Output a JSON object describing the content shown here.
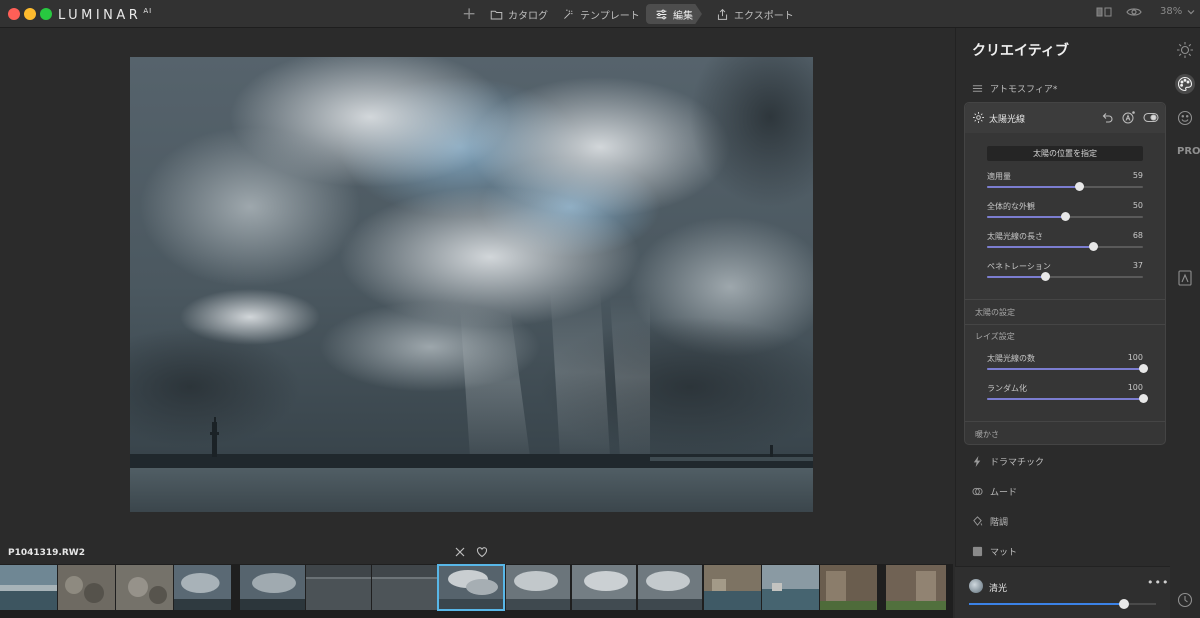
{
  "app": {
    "logo": "LUMINAR",
    "logo_suffix": "AI"
  },
  "nav": {
    "catalog": "カタログ",
    "template": "テンプレート",
    "edit": "編集",
    "export": "エクスポート",
    "zoom": "38%"
  },
  "filename": "P1041319.RW2",
  "panel": {
    "title": "クリエイティブ",
    "atmosphere": "アトモスフィア*",
    "sunrays": {
      "title": "太陽光線",
      "place_sun_button": "太陽の位置を指定",
      "sliders": [
        {
          "label": "適用量",
          "value": 59,
          "fraction": 0.59
        },
        {
          "label": "全体的な外観",
          "value": 50,
          "fraction": 0.5
        },
        {
          "label": "太陽光線の長さ",
          "value": 68,
          "fraction": 0.68
        },
        {
          "label": "ペネトレーション",
          "value": 37,
          "fraction": 0.37
        }
      ],
      "sun_settings": "太陽の設定",
      "ray_settings": "レイズ設定",
      "ray_sliders": [
        {
          "label": "太陽光線の数",
          "value": 100,
          "fraction": 1.0
        },
        {
          "label": "ランダム化",
          "value": 100,
          "fraction": 1.0
        }
      ],
      "warmth": "暖かさ"
    },
    "dramatic": "ドラマチック",
    "mood": "ムード",
    "toning": "階調",
    "matte": "マット"
  },
  "preset": {
    "name": "清光",
    "more": "•••",
    "fraction": 0.83
  },
  "rail": {
    "pro": "PRO"
  },
  "colors": {
    "accent_slider": "#7b7dd0",
    "preset_slider": "#3b82e6",
    "selected_thumb": "#58b7e8"
  }
}
